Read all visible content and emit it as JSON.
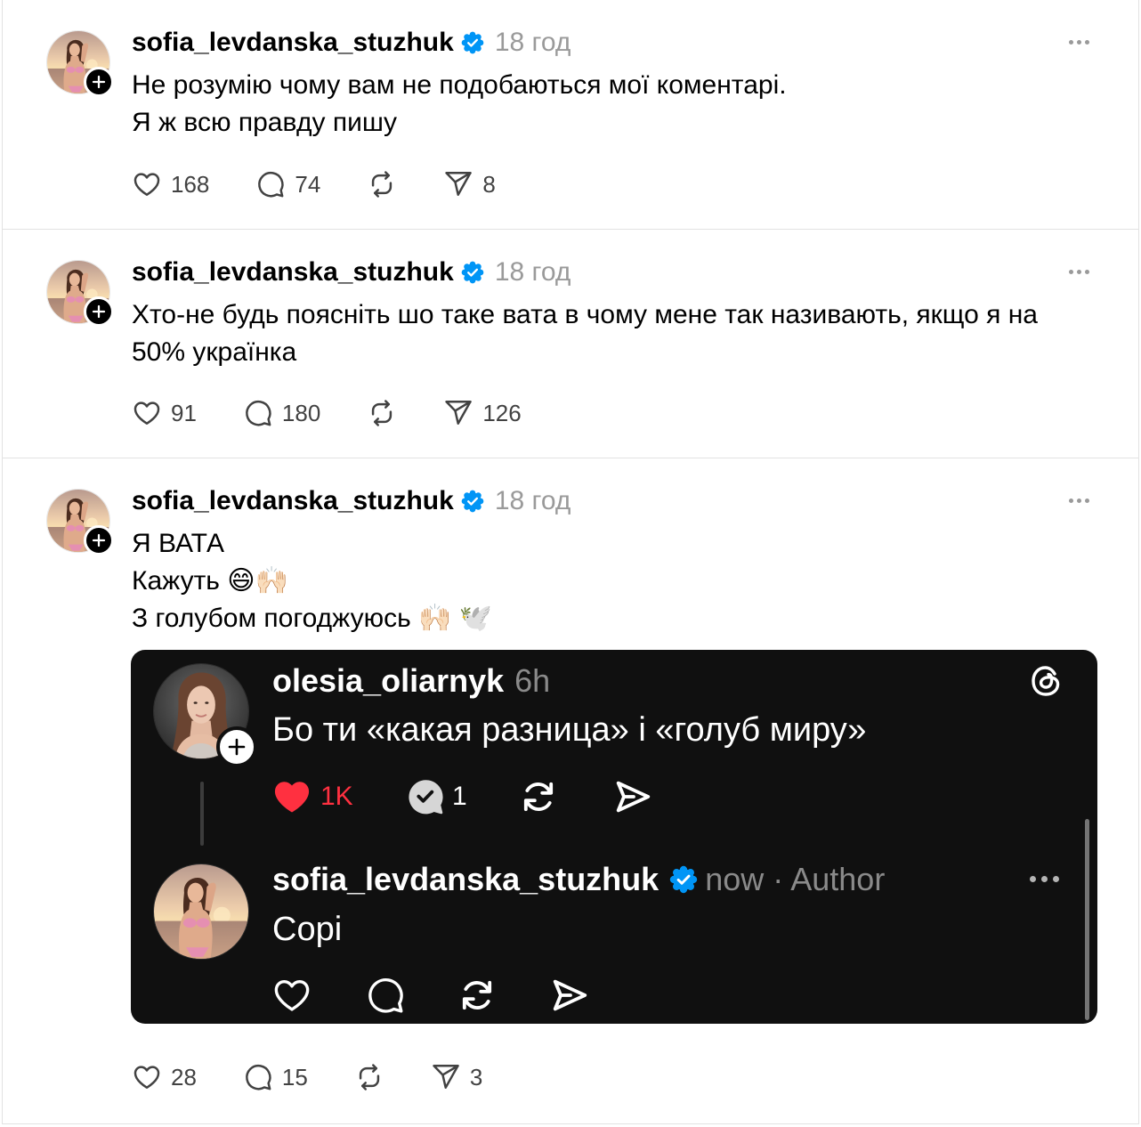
{
  "colors": {
    "text": "#000000",
    "muted": "#9a9a9a",
    "verified": "#0095f6",
    "like_red": "#ff3040",
    "embed_background": "#101010"
  },
  "icons": {
    "like": "heart-icon",
    "reply": "comment-icon",
    "repost": "repost-icon",
    "share": "share-icon",
    "more": "more-icon",
    "verified": "verified-badge-icon",
    "follow": "plus-icon",
    "app": "threads-logo-icon"
  },
  "posts": [
    {
      "username": "sofia_levdanska_stuzhuk",
      "time": "18 год",
      "text_lines": [
        "Не розумію чому вам не подобаються мої коментарі.",
        "Я ж всю правду пишу"
      ],
      "stats": {
        "likes": "168",
        "replies": "74",
        "shares": "8"
      }
    },
    {
      "username": "sofia_levdanska_stuzhuk",
      "time": "18 год",
      "text_lines": [
        "Хто-не будь поясніть шо таке вата в чому мене так називають, якщо я на",
        "50% українка"
      ],
      "stats": {
        "likes": "91",
        "replies": "180",
        "shares": "126"
      }
    },
    {
      "username": "sofia_levdanska_stuzhuk",
      "time": "18 год",
      "text_lines": [
        "Я ВАТА",
        "Кажуть 😄🙌🏻",
        "З голубом погоджуюсь 🙌🏻 🕊️"
      ],
      "stats": {
        "likes": "28",
        "replies": "15",
        "shares": "3"
      },
      "embedded_screenshot": {
        "comment": {
          "username": "olesia_oliarnyk",
          "time": "6h",
          "text": "Бо ти «какая разница» і «голуб миру»",
          "likes": "1K",
          "replies": "1",
          "liked": true
        },
        "reply": {
          "username": "sofia_levdanska_stuzhuk",
          "verified": true,
          "meta": "now · Author",
          "text": "Сорі"
        }
      }
    }
  ]
}
